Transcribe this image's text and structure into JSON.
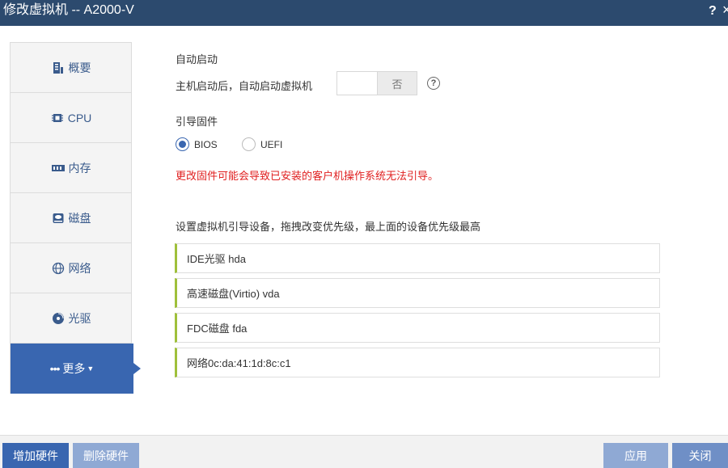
{
  "window": {
    "title": "修改虚拟机 -- A2000-V",
    "help": "?",
    "close": "×"
  },
  "sidebar": {
    "items": [
      {
        "label": "概要",
        "icon": "summary-icon"
      },
      {
        "label": "CPU",
        "icon": "cpu-icon"
      },
      {
        "label": "内存",
        "icon": "memory-icon"
      },
      {
        "label": "磁盘",
        "icon": "disk-icon"
      },
      {
        "label": "网络",
        "icon": "network-icon"
      },
      {
        "label": "光驱",
        "icon": "cdrom-icon"
      },
      {
        "label": "更多",
        "icon": "more-icon",
        "prefix": "•••"
      }
    ]
  },
  "autostart": {
    "section_title": "自动启动",
    "label": "主机启动后，自动启动虚拟机",
    "toggle_value": "否"
  },
  "firmware": {
    "section_title": "引导固件",
    "options": [
      "BIOS",
      "UEFI"
    ],
    "selected": "BIOS",
    "warning": "更改固件可能会导致已安装的客户机操作系统无法引导。"
  },
  "boot": {
    "label": "设置虚拟机引导设备，拖拽改变优先级，最上面的设备优先级最高",
    "devices": [
      "IDE光驱 hda",
      "高速磁盘(Virtio) vda",
      "FDC磁盘 fda",
      "网络0c:da:41:1d:8c:c1"
    ]
  },
  "footer": {
    "add_hardware": "增加硬件",
    "remove_hardware": "删除硬件",
    "apply": "应用",
    "close": "关闭"
  },
  "colors": {
    "accent": "#3966b0",
    "titlebar": "#2c4a6e",
    "warning": "#e02020",
    "device_border": "#9fc03b"
  }
}
